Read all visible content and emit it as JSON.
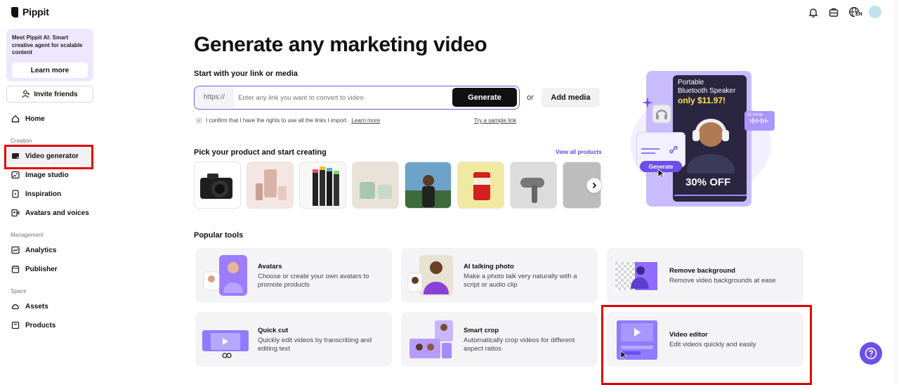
{
  "app": {
    "name": "Pippit",
    "language_badge": "EN"
  },
  "sidebar": {
    "promo": {
      "text": "Meet Pippit AI: Smart creative agent for scalable content",
      "button": "Learn more"
    },
    "invite_label": "Invite friends",
    "home": "Home",
    "sections": [
      {
        "label": "Creation",
        "items": [
          "Video generator",
          "Image studio",
          "Inspiration",
          "Avatars and voices"
        ]
      },
      {
        "label": "Management",
        "items": [
          "Analytics",
          "Publisher"
        ]
      },
      {
        "label": "Space",
        "items": [
          "Assets",
          "Products"
        ]
      }
    ]
  },
  "main": {
    "title": "Generate any marketing video",
    "link_section": {
      "heading": "Start with your link or media",
      "prefix": "https://",
      "placeholder": "Enter any link you want to convert to video",
      "generate": "Generate",
      "or": "or",
      "add_media": "Add media",
      "confirm_text": "I confirm that I have the rights to use all the links I import.",
      "learn_more": "Learn more",
      "try_sample": "Try a sample link"
    },
    "products": {
      "heading": "Pick your product and start creating",
      "view_all": "View all products"
    },
    "hero": {
      "card_line1": "Portable",
      "card_line2": "Bluetooth Speaker",
      "price": "only $11.97!",
      "discount": "30% OFF",
      "generate_pill": "Generate",
      "ai_voice": "AI Vocie"
    },
    "popular": {
      "heading": "Popular tools",
      "tools": [
        {
          "title": "Avatars",
          "desc": "Choose or create your own avatars to promote products"
        },
        {
          "title": "AI talking photo",
          "desc": "Make a photo talk very naturally with a script or audio clip"
        },
        {
          "title": "Remove background",
          "desc": "Remove video backgrounds at ease"
        },
        {
          "title": "Quick cut",
          "desc": "Quickly edit videos by transcribing and editing text"
        },
        {
          "title": "Smart crop",
          "desc": "Automatically crop videos for different aspect ratios"
        },
        {
          "title": "Video editor",
          "desc": "Edit videos quickly and easily"
        }
      ]
    }
  },
  "colors": {
    "accent": "#6d4ee8",
    "highlight": "#e00000",
    "card_bg": "#f4f4f6"
  }
}
